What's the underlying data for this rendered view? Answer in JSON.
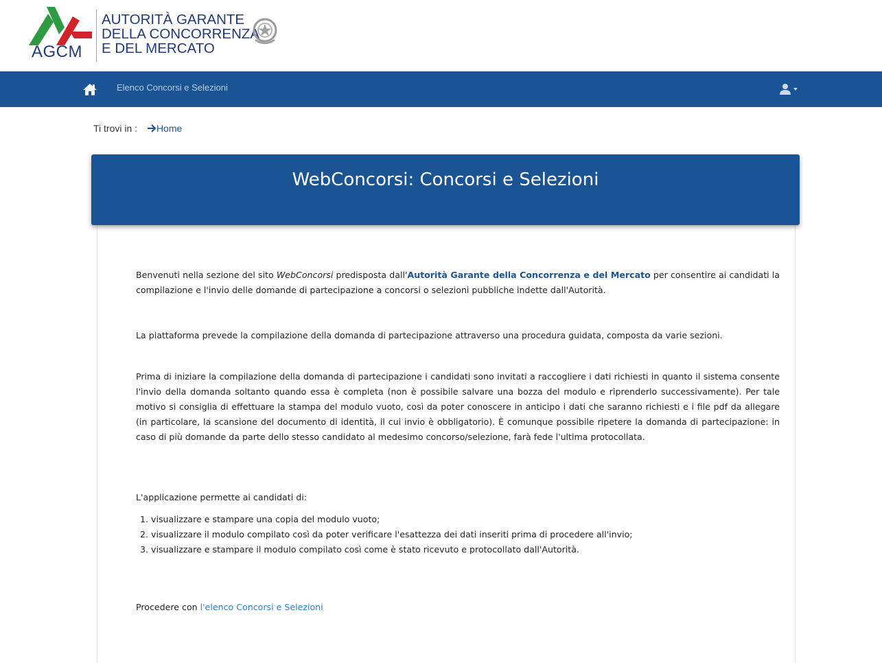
{
  "brand": {
    "acronym": "AGCM",
    "name_line1": "AUTORITÀ GARANTE",
    "name_line2": "DELLA CONCORRENZA",
    "name_line3": "E DEL MERCATO",
    "colors": {
      "green": "#2e9a44",
      "red": "#d2232a",
      "navy": "#233a78"
    },
    "emblem_icon": "italian-republic-emblem"
  },
  "navbar": {
    "home_icon": "home-icon",
    "link_label": "Elenco Concorsi e Selezioni",
    "user_icon": "user-icon",
    "background": "#1a5494"
  },
  "breadcrumb": {
    "prefix": "Ti trovi in :",
    "home_label": "Home"
  },
  "panel": {
    "title": "WebConcorsi: Concorsi e Selezioni"
  },
  "content": {
    "p1_before": "Benvenuti nella sezione del sito ",
    "p1_italic": "WebConcorsi",
    "p1_middle": " predisposta dall'",
    "p1_bold": "Autorità Garante della Concorrenza e del Mercato",
    "p1_after": " per consentire ai candidati la compilazione e l'invio delle domande di partecipazione a concorsi o selezioni pubbliche indette dall'Autorità.",
    "p2": "La piattaforma prevede la compilazione della domanda di partecipazione attraverso una procedura guidata, composta da varie sezioni.",
    "p3": "Prima di iniziare la compilazione della domanda di partecipazione i candidati sono invitati a raccogliere i dati richiesti in quanto il sistema consente l'invio della domanda soltanto quando essa è completa (non è possibile salvare una bozza del modulo e riprenderlo successivamente). Per tale motivo si consiglia di effettuare la stampa del modulo vuoto, così da poter conoscere in anticipo i dati che saranno richiesti e i file pdf da allegare (in particolare, la scansione del documento di identità, il cui invio è obbligatorio). È comunque possibile ripetere la domanda di partecipazione: in caso di più domande da parte dello stesso candidato al medesimo concorso/selezione, farà fede l'ultima protocollata.",
    "p4": "L'applicazione permette ai candidati di:",
    "list": [
      "visualizzare e stampare una copia del modulo vuoto;",
      "visualizzare il modulo compilato così da poter verificare l'esattezza dei dati inseriti prima di procedere all'invio;",
      "visualizzare e stampare il modulo compilato così come è stato ricevuto e protocollato dall'Autorità."
    ],
    "p5_before": "Procedere con ",
    "p5_link": "l'elenco Concorsi e Selezioni"
  }
}
